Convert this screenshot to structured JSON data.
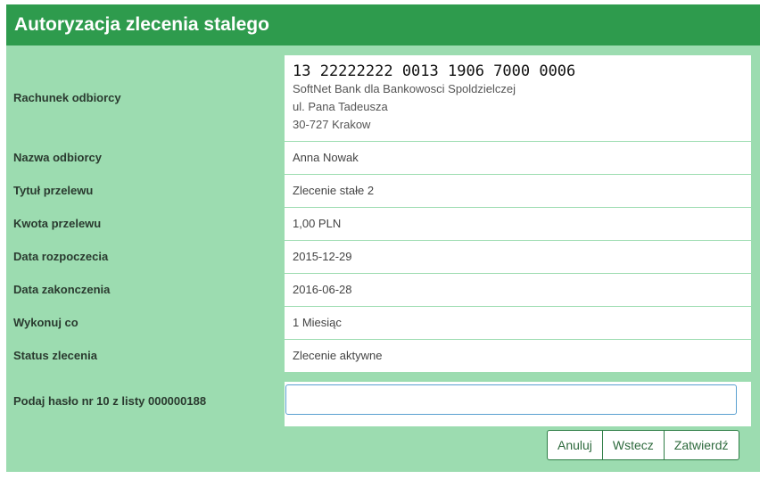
{
  "header": {
    "title": "Autoryzacja zlecenia stalego"
  },
  "recipient_account": {
    "label": "Rachunek odbiorcy",
    "number": "13 22222222 0013 1906 7000 0006",
    "bank_line1": "SoftNet Bank dla Bankowosci Spoldzielczej",
    "bank_line2": "ul. Pana Tadeusza",
    "bank_line3": "30-727 Krakow"
  },
  "fields": [
    {
      "label": "Nazwa odbiorcy",
      "value": "Anna Nowak"
    },
    {
      "label": "Tytuł przelewu",
      "value": "Zlecenie stałe 2"
    },
    {
      "label": "Kwota przelewu",
      "value": "1,00 PLN"
    },
    {
      "label": "Data rozpoczecia",
      "value": "2015-12-29"
    },
    {
      "label": "Data zakonczenia",
      "value": "2016-06-28"
    },
    {
      "label": "Wykonuj co",
      "value": "1 Miesiąc"
    },
    {
      "label": "Status zlecenia",
      "value": "Zlecenie aktywne"
    }
  ],
  "password": {
    "label": "Podaj hasło nr 10 z listy 000000188",
    "value": ""
  },
  "buttons": {
    "cancel": "Anuluj",
    "back": "Wstecz",
    "confirm": "Zatwierdź"
  }
}
